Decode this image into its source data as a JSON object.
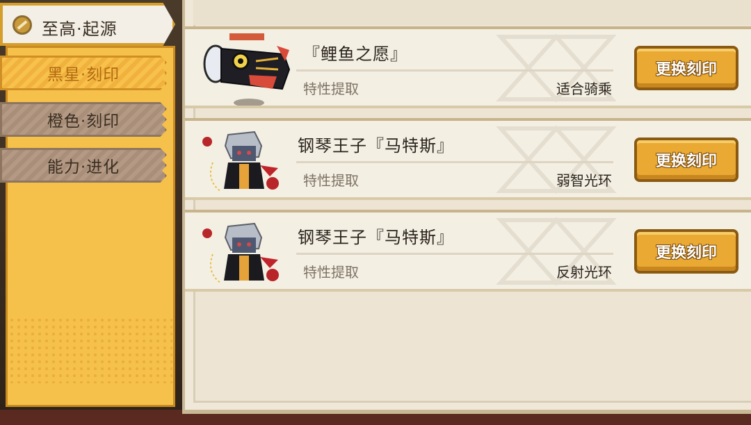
{
  "sidebar": {
    "header_title": "至高·起源",
    "tabs": [
      {
        "label": "黑星·刻印",
        "active": true
      },
      {
        "label": "橙色·刻印",
        "active": false
      },
      {
        "label": "能力·进化",
        "active": false
      }
    ]
  },
  "cards": [
    {
      "name": "『鲤鱼之愿』",
      "sub_label": "特性提取",
      "value": "适合骑乘",
      "button_label": "更换刻印",
      "sprite": "koi-windsock-icon"
    },
    {
      "name": "钢琴王子『马特斯』",
      "sub_label": "特性提取",
      "value": "弱智光环",
      "button_label": "更换刻印",
      "sprite": "piano-prince-icon"
    },
    {
      "name": "钢琴王子『马特斯』",
      "sub_label": "特性提取",
      "value": "反射光环",
      "button_label": "更换刻印",
      "sprite": "piano-prince-icon"
    }
  ],
  "colors": {
    "accent": "#f6c14a",
    "button": "#e9a932",
    "panel": "#efe8d9"
  }
}
